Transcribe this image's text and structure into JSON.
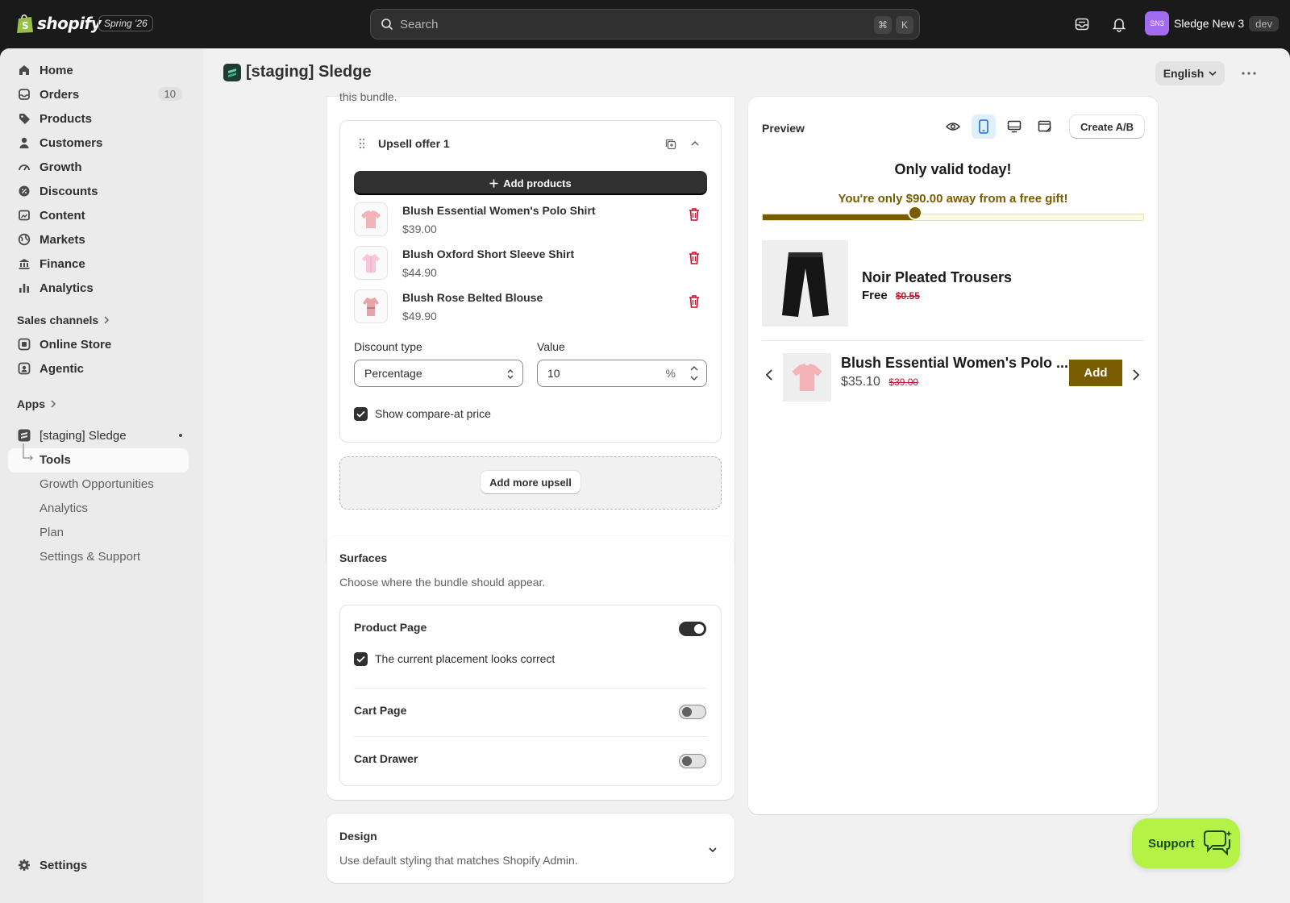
{
  "topbar": {
    "brand": "shopify",
    "edition": "Spring '26",
    "search_placeholder": "Search",
    "shortcut_cmd": "⌘",
    "shortcut_key": "K",
    "account_initials": "SN3",
    "account_name": "Sledge New 3",
    "account_badge": "dev"
  },
  "sidebar": {
    "items": [
      {
        "label": "Home",
        "icon": "home-icon"
      },
      {
        "label": "Orders",
        "icon": "orders-icon",
        "count": "10"
      },
      {
        "label": "Products",
        "icon": "tag-icon"
      },
      {
        "label": "Customers",
        "icon": "person-icon"
      },
      {
        "label": "Growth",
        "icon": "gauge-icon"
      },
      {
        "label": "Discounts",
        "icon": "discount-icon"
      },
      {
        "label": "Content",
        "icon": "content-icon"
      },
      {
        "label": "Markets",
        "icon": "globe-icon"
      },
      {
        "label": "Finance",
        "icon": "bank-icon"
      },
      {
        "label": "Analytics",
        "icon": "bar-chart-icon"
      }
    ],
    "sales_channels_label": "Sales channels",
    "channels": [
      {
        "label": "Online Store",
        "icon": "store-icon"
      },
      {
        "label": "Agentic",
        "icon": "agentic-icon"
      }
    ],
    "apps_label": "Apps",
    "app_name": "[staging] Sledge",
    "app_subitems": [
      "Tools",
      "Growth Opportunities",
      "Analytics",
      "Plan",
      "Settings & Support"
    ],
    "settings_label": "Settings"
  },
  "header": {
    "title": "[staging] Sledge",
    "language": "English"
  },
  "upsell_card": {
    "clipped_text": "this bundle.",
    "offer_title": "Upsell offer 1",
    "add_products_label": "Add products",
    "products": [
      {
        "name": "Blush Essential Women's Polo Shirt",
        "price": "$39.00"
      },
      {
        "name": "Blush Oxford Short Sleeve Shirt",
        "price": "$44.90"
      },
      {
        "name": "Blush Rose Belted Blouse",
        "price": "$49.90"
      }
    ],
    "discount_type_label": "Discount type",
    "discount_type_value": "Percentage",
    "value_label": "Value",
    "value": "10",
    "value_suffix": "%",
    "show_compare_label": "Show compare-at price",
    "show_compare_checked": true,
    "add_more_label": "Add more upsell"
  },
  "surfaces_card": {
    "title": "Surfaces",
    "subtitle": "Choose where the bundle should appear.",
    "product_page_label": "Product Page",
    "product_page_on": true,
    "placement_label": "The current placement looks correct",
    "cart_page_label": "Cart Page",
    "cart_page_on": false,
    "cart_drawer_label": "Cart Drawer",
    "cart_drawer_on": false
  },
  "design_card": {
    "title": "Design",
    "subtitle": "Use default styling that matches Shopify Admin."
  },
  "preview": {
    "title": "Preview",
    "create_ab_label": "Create A/B",
    "headline": "Only valid today!",
    "progress_text": "You're only $90.00 away from a free gift!",
    "progress_fraction": 0.4,
    "gift_name": "Noir Pleated Trousers",
    "gift_price": "Free",
    "gift_compare_price": "$0.55",
    "upsell_name": "Blush Essential Women's Polo ...",
    "upsell_price": "$35.10",
    "upsell_compare_price": "$39.00",
    "add_label": "Add",
    "accent_color": "#7a5c00"
  },
  "support_label": "Support"
}
